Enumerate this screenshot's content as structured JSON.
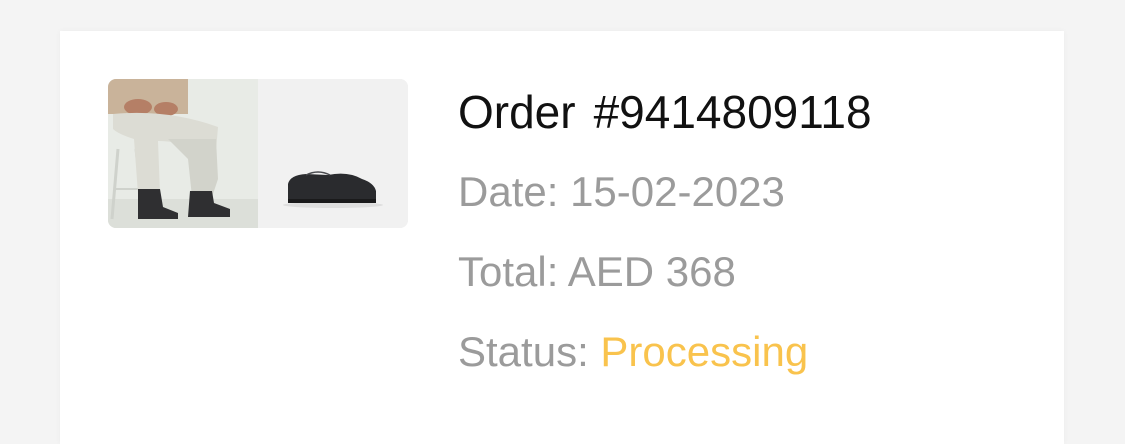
{
  "order": {
    "label": "Order",
    "number": "#9414809118",
    "date_label": "Date:",
    "date_value": "15-02-2023",
    "total_label": "Total:",
    "total_value": "AED 368",
    "status_label": "Status:",
    "status_value": "Processing"
  },
  "colors": {
    "status_processing": "#f9c34d",
    "muted_text": "#9b9b9b",
    "title_text": "#111111"
  },
  "images": [
    "product-photo-model-wearing-boots",
    "product-photo-shoe-side"
  ]
}
